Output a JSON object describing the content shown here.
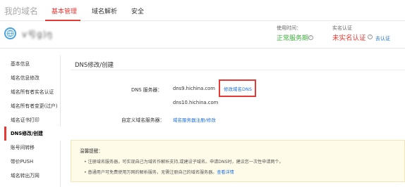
{
  "topbar": {
    "brand": "我的域名",
    "tabs": [
      {
        "label": "基本管理",
        "active": true
      },
      {
        "label": "域名解析",
        "active": false
      },
      {
        "label": "安全",
        "active": false
      }
    ],
    "accent_color": "#e53935"
  },
  "domain": {
    "name": "ⅴ亏ɡ)ŋ",
    "usage_time_label": "使用时间：",
    "service_status": "正常服务期",
    "realname_label": "实名认证",
    "realname_status": "未实名认证",
    "verify_link": "去认证"
  },
  "sidebar": {
    "items": [
      {
        "label": "基本信息",
        "active": false
      },
      {
        "label": "域名信息修改",
        "active": false
      },
      {
        "label": "域名所有者实名认证",
        "active": false
      },
      {
        "label": "域名所有者变更(过户)",
        "active": false
      },
      {
        "label": "域名证书打印",
        "active": false
      },
      {
        "label": "DNS修改/创建",
        "active": true
      },
      {
        "label": "账号间转移",
        "active": false
      },
      {
        "label": "带价PUSH",
        "active": false
      },
      {
        "label": "域名转出万网",
        "active": false
      }
    ]
  },
  "content": {
    "title": "DNS修改/创建",
    "dns_label": "DNS 服务器：",
    "dns_servers": [
      "dns9.hichina.com",
      "dns10.hichina.com"
    ],
    "edit_dns_link": "修改域名DNS",
    "custom_dns_label": "自定义域名服务器：",
    "custom_dns_link": "域名服务器注册/修改"
  },
  "notice": {
    "title": "温馨提醒：",
    "line1": "• 注册域名服务器，可实现自己为域名作解析支持,或建设子域名。申请DNS时，建议您一次性申请两个。",
    "line2": "• 普通用户可免费使用万网的解析服务，无需注册自己的域名服务器。",
    "line2_link": "查看详情"
  }
}
